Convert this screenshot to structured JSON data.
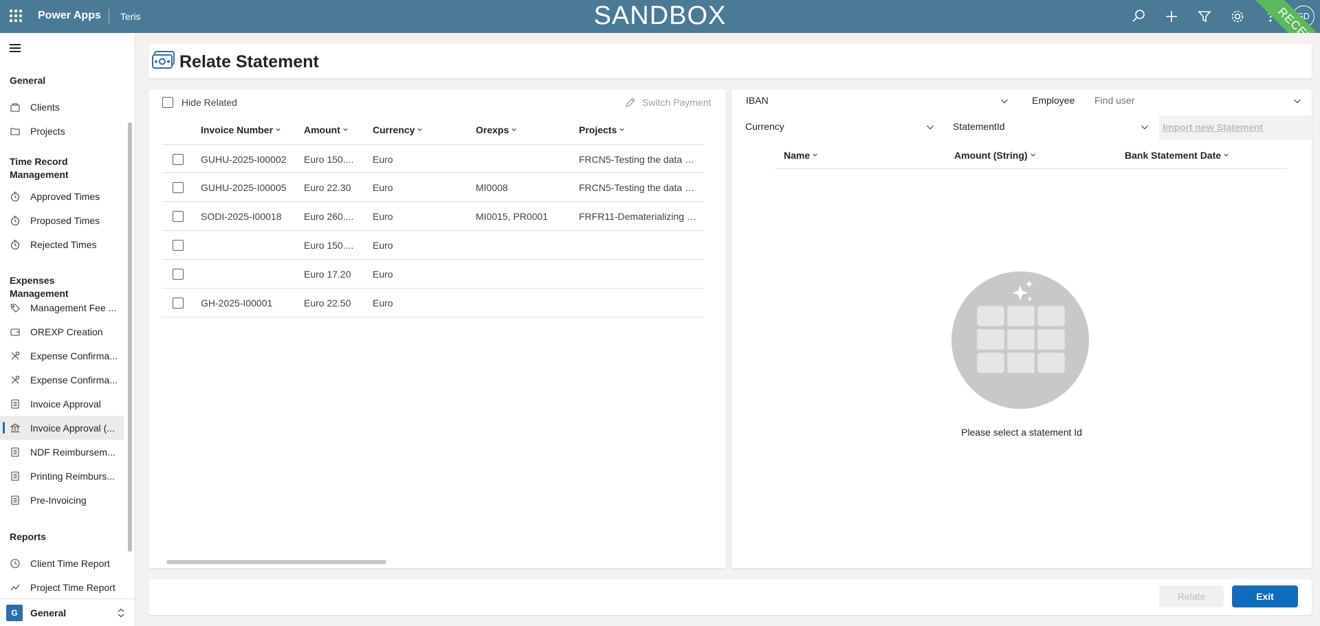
{
  "topbar": {
    "app_name": "Power Apps",
    "environment": "Teris",
    "banner": "SANDBOX",
    "ribbon": "RECETTE",
    "avatar_initials": "SD",
    "bg_color": "#4a7a96"
  },
  "sidebar": {
    "groups": [
      {
        "label": "General",
        "items": [
          {
            "label": "Clients",
            "icon": "clients-icon"
          },
          {
            "label": "Projects",
            "icon": "projects-icon"
          }
        ]
      },
      {
        "label": "Time Record Management",
        "items": [
          {
            "label": "Approved Times",
            "icon": "timer-icon"
          },
          {
            "label": "Proposed Times",
            "icon": "timer-icon"
          },
          {
            "label": "Rejected Times",
            "icon": "timer-icon"
          }
        ]
      },
      {
        "label": "Expenses Management",
        "items": [
          {
            "label": "Management Fee ...",
            "icon": "tag-icon"
          },
          {
            "label": "OREXP Creation",
            "icon": "wallet-icon"
          },
          {
            "label": "Expense Confirma...",
            "icon": "tools-icon"
          },
          {
            "label": "Expense Confirma...",
            "icon": "tools-icon"
          },
          {
            "label": "Invoice Approval",
            "icon": "document-icon"
          },
          {
            "label": "Invoice Approval (...",
            "icon": "bank-icon"
          },
          {
            "label": "NDF Reimbursem...",
            "icon": "document-icon"
          },
          {
            "label": "Printing Reimburs...",
            "icon": "document-icon"
          },
          {
            "label": "Pre-Invoicing",
            "icon": "document-icon"
          }
        ]
      },
      {
        "label": "Reports",
        "items": [
          {
            "label": "Client Time Report",
            "icon": "clock-icon"
          },
          {
            "label": "Project Time Report",
            "icon": "line-chart-icon"
          }
        ]
      }
    ],
    "area": {
      "badge": "G",
      "label": "General"
    }
  },
  "page": {
    "title": "Relate Statement"
  },
  "left": {
    "hide_related_label": "Hide Related",
    "switch_payment_label": "Switch Payment",
    "columns": [
      "Invoice Number",
      "Amount",
      "Currency",
      "Orexps",
      "Projects"
    ],
    "rows": [
      [
        "GUHU-2025-I00002",
        "Euro 150....",
        "Euro",
        "",
        "FRCN5-Testing the data b..."
      ],
      [
        "GUHU-2025-I00005",
        "Euro 22.30",
        "Euro",
        "MI0008",
        "FRCN5-Testing the data b..."
      ],
      [
        "SODI-2025-I00018",
        "Euro 260....",
        "Euro",
        "MI0015, PR0001",
        "FRFR11-Dematerializing C..."
      ],
      [
        "",
        "Euro 150....",
        "Euro",
        "",
        ""
      ],
      [
        "",
        "Euro 17.20",
        "Euro",
        "",
        ""
      ],
      [
        "GH-2025-I00001",
        "Euro 22.50",
        "Euro",
        "",
        ""
      ]
    ]
  },
  "right": {
    "iban_label": "IBAN",
    "employee_label": "Employee",
    "find_user_placeholder": "Find user",
    "currency_label": "Currency",
    "statement_id_label": "StatementId",
    "import_label": "Import new Statement",
    "columns": [
      "Name",
      "Amount (String)",
      "Bank Statement Date"
    ],
    "empty_message": "Please select a statement Id"
  },
  "footer": {
    "relate_label": "Relate",
    "exit_label": "Exit",
    "exit_color": "#0f6cbd"
  }
}
